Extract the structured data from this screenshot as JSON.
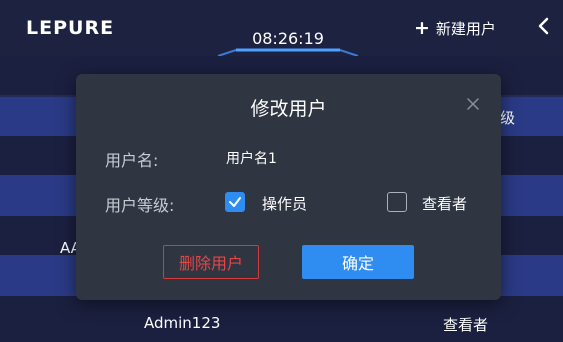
{
  "header": {
    "logo": "LEPURE",
    "time": "08:26:19",
    "new_user_label": "新建用户",
    "new_user_icon": "plus-icon",
    "back_icon": "chevron-left-icon"
  },
  "table": {
    "partial_texts": {
      "row2_right": "级",
      "row5_left": "AA"
    },
    "bottom_row": {
      "username": "Admin123",
      "level": "查看者"
    }
  },
  "modal": {
    "title": "修改用户",
    "close_icon": "close-icon",
    "username_label": "用户名:",
    "username_value": "用户名1",
    "level_label": "用户等级:",
    "options": [
      {
        "label": "操作员",
        "checked": true
      },
      {
        "label": "查看者",
        "checked": false
      }
    ],
    "delete_label": "删除用户",
    "confirm_label": "确定"
  },
  "colors": {
    "accent_blue": "#2f8cf0",
    "danger_red": "#e14848",
    "row_highlight": "#2b3a86",
    "background": "#1f2544"
  }
}
